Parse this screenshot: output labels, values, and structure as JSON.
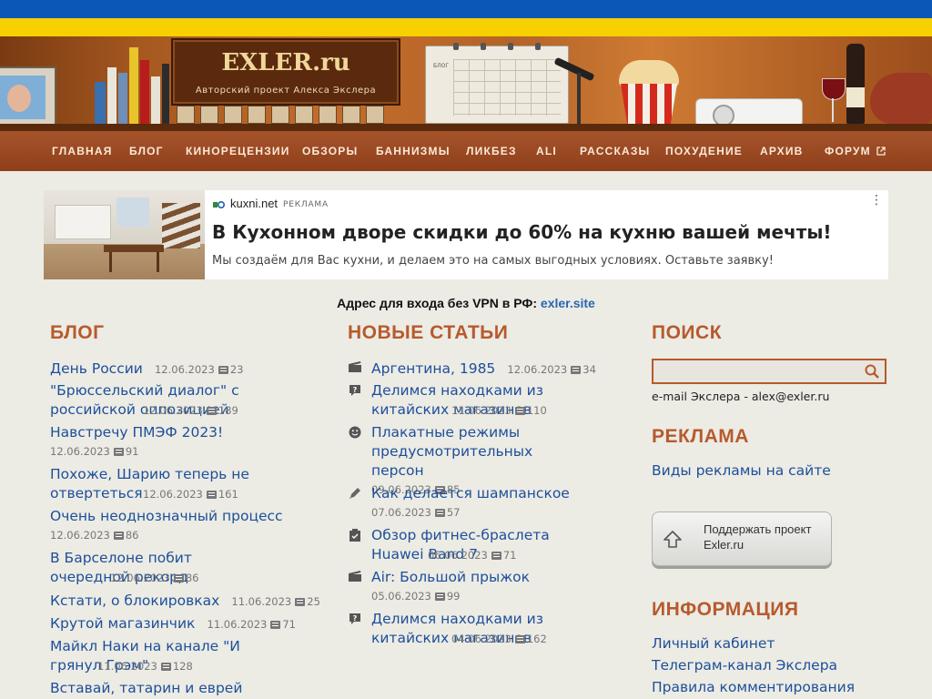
{
  "site": {
    "logo": "EXLER.ru",
    "tagline": "Авторский проект Алекса Экслера",
    "calendar_label": "БЛОГ"
  },
  "nav": [
    {
      "label": "ГЛАВНАЯ"
    },
    {
      "label": "БЛОГ"
    },
    {
      "label": "КИНОРЕЦЕНЗИИ"
    },
    {
      "label": "ОБЗОРЫ"
    },
    {
      "label": "БАННИЗМЫ"
    },
    {
      "label": "ЛИКБЕЗ"
    },
    {
      "label": "ALI"
    },
    {
      "label": "РАССКАЗЫ"
    },
    {
      "label": "ПОХУДЕНИЕ"
    },
    {
      "label": "АРХИВ"
    },
    {
      "label": "ФОРУМ"
    }
  ],
  "ad": {
    "site": "kuxni.net",
    "tag": "РЕКЛАМА",
    "title": "В Кухонном дворе скидки до 60% на кухню вашей мечты!",
    "description": "Мы создаём для Вас кухни, и делаем это на самых выгодных условиях. Оставьте заявку!",
    "menu": "⋮"
  },
  "vpn": {
    "text": "Адрес для входа без VPN в РФ: ",
    "link": "exler.site"
  },
  "blog": {
    "title": "БЛОГ",
    "items": [
      {
        "title": "День России",
        "date": "12.06.2023",
        "comments": "23"
      },
      {
        "title": "\"Брюссельский диалог\" с российской оппозицией",
        "date": "12.06.2023",
        "comments": "189"
      },
      {
        "title": "Навстречу ПМЭФ 2023!",
        "date": "12.06.2023",
        "comments": "91"
      },
      {
        "title": "Похоже, Шарию теперь не отвертеться",
        "date": "12.06.2023",
        "comments": "161"
      },
      {
        "title": "Очень неоднозначный процесс",
        "date": "12.06.2023",
        "comments": "86"
      },
      {
        "title": "В Барселоне побит очередной рекорд",
        "date": "12.06.2023",
        "comments": "86"
      },
      {
        "title": "Кстати, о блокировках",
        "date": "11.06.2023",
        "comments": "25"
      },
      {
        "title": "Крутой магазинчик",
        "date": "11.06.2023",
        "comments": "71"
      },
      {
        "title": "Майкл Наки на канале \"И грянул Грэм\"",
        "date": "11.06.2023",
        "comments": "128"
      },
      {
        "title": "Вставай, татарин и еврей",
        "date": "",
        "comments": ""
      }
    ]
  },
  "articles": {
    "title": "НОВЫЕ СТАТЬИ",
    "items": [
      {
        "icon": "film-icon",
        "title": "Аргентина, 1985",
        "date": "12.06.2023",
        "comments": "34"
      },
      {
        "icon": "question-icon",
        "title": "Делимся находками из китайских магазинов",
        "date": "11.06.2023",
        "comments": "110"
      },
      {
        "icon": "smiley-icon",
        "title": "Плакатные режимы предусмотрительных персон",
        "date": "09.06.2023",
        "comments": "85"
      },
      {
        "icon": "pencil-icon",
        "title": "Как делается шампанское",
        "date": "07.06.2023",
        "comments": "57"
      },
      {
        "icon": "checklist-icon",
        "title": "Обзор фитнес-браслета Huawei Band 7",
        "date": "06.06.2023",
        "comments": "71"
      },
      {
        "icon": "film-icon",
        "title": "Air: Большой прыжок",
        "date": "05.06.2023",
        "comments": "99"
      },
      {
        "icon": "question-icon",
        "title": "Делимся находками из китайских магазинов",
        "date": "04.06.2023",
        "comments": "162"
      }
    ]
  },
  "search": {
    "title": "ПОИСК",
    "placeholder": "",
    "email_text": "e-mail Экслера - alex@exler.ru"
  },
  "advert": {
    "title": "РЕКЛАМА",
    "link": "Виды рекламы на сайте"
  },
  "support": {
    "line1": "Поддержать проект",
    "line2": "Exler.ru"
  },
  "info": {
    "title": "ИНФОРМАЦИЯ",
    "links": [
      "Личный кабинет",
      "Телеграм-канал Экслера",
      "Правила комментирования"
    ]
  },
  "colors": {
    "flag_blue": "#0b57b8",
    "flag_yellow": "#f7d000",
    "nav_bg": "#9c4a22",
    "section_title": "#b75a2d",
    "link": "#1d4f9a"
  }
}
